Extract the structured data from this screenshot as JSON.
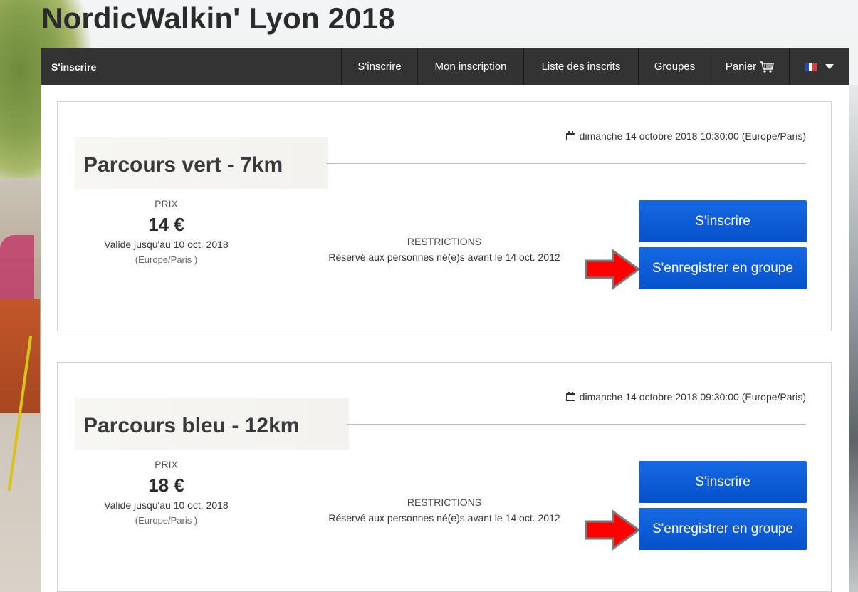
{
  "page": {
    "title": "NordicWalkin' Lyon 2018"
  },
  "navbar": {
    "brand": "S'inscrire",
    "items": [
      {
        "label": "S'inscrire"
      },
      {
        "label": "Mon inscription"
      },
      {
        "label": "Liste des inscrits"
      },
      {
        "label": "Groupes"
      },
      {
        "label": "Panier"
      }
    ],
    "language_flag": "fr-flag-icon",
    "cart_icon": "cart-icon"
  },
  "events": [
    {
      "date": "dimanche 14 octobre 2018 10:30:00 (Europe/Paris)",
      "name": "Parcours vert - 7km",
      "price_label": "PRIX",
      "price": "14 €",
      "valid_until": "Valide jusqu'au 10 oct. 2018",
      "timezone": "(Europe/Paris )",
      "restrictions_label": "RESTRICTIONS",
      "restrictions_text": "Réservé aux personnes né(e)s avant le 14 oct. 2012",
      "register_button": "S'inscrire",
      "group_button": "S'enregistrer en groupe"
    },
    {
      "date": "dimanche 14 octobre 2018 09:30:00 (Europe/Paris)",
      "name": "Parcours bleu - 12km",
      "price_label": "PRIX",
      "price": "18 €",
      "valid_until": "Valide jusqu'au 10 oct. 2018",
      "timezone": "(Europe/Paris )",
      "restrictions_label": "RESTRICTIONS",
      "restrictions_text": "Réservé aux personnes né(e)s avant le 14 oct. 2012",
      "register_button": "S'inscrire",
      "group_button": "S'enregistrer en groupe"
    }
  ],
  "colors": {
    "navbar_bg": "#333333",
    "button_blue": "#0a5ad4",
    "arrow_red": "#ff0000"
  }
}
